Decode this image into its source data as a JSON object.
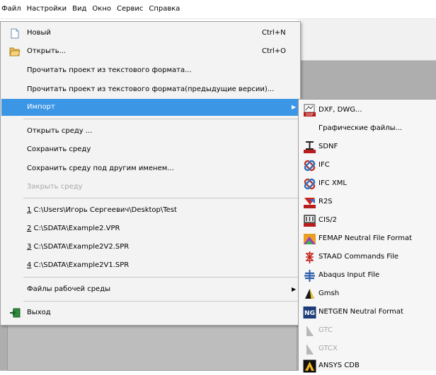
{
  "menubar": {
    "items": [
      "Файл",
      "Настройки",
      "Вид",
      "Окно",
      "Сервис",
      "Справка"
    ]
  },
  "file_menu": {
    "new": {
      "label": "Новый",
      "shortcut": "Ctrl+N",
      "icon": "new-file-icon"
    },
    "open": {
      "label": "Открыть...",
      "shortcut": "Ctrl+O",
      "icon": "open-folder-icon"
    },
    "read_text": {
      "label": "Прочитать проект из текстового формата..."
    },
    "read_text_old": {
      "label": "Прочитать проект из текстового формата(предыдущие версии)..."
    },
    "import": {
      "label": "Импорт"
    },
    "open_env": {
      "label": "Открыть среду ..."
    },
    "save_env": {
      "label": "Сохранить среду"
    },
    "save_env_as": {
      "label": "Сохранить среду под другим именем..."
    },
    "close_env": {
      "label": "Закрыть среду"
    },
    "recent": [
      {
        "num": "1",
        "path": " C:\\Users\\Игорь Сергеевич\\Desktop\\Test"
      },
      {
        "num": "2",
        "path": " C:\\SDATA\\Example2.VPR"
      },
      {
        "num": "3",
        "path": " C:\\SDATA\\Example2V2.SPR"
      },
      {
        "num": "4",
        "path": " C:\\SDATA\\Example2V1.SPR"
      }
    ],
    "workspace_files": {
      "label": "Файлы рабочей среды"
    },
    "exit": {
      "label": "Выход",
      "icon": "exit-icon"
    }
  },
  "import_submenu": [
    {
      "label": "DXF, DWG...",
      "icon": "dxf-icon",
      "enabled": true
    },
    {
      "label": "Графические файлы...",
      "icon": "",
      "enabled": true
    },
    {
      "label": "SDNF",
      "icon": "sdnf-icon",
      "enabled": true
    },
    {
      "label": "IFC",
      "icon": "ifc-icon",
      "enabled": true
    },
    {
      "label": "IFC XML",
      "icon": "ifc-xml-icon",
      "enabled": true
    },
    {
      "label": "R2S",
      "icon": "r2s-icon",
      "enabled": true
    },
    {
      "label": "CIS/2",
      "icon": "cis2-icon",
      "enabled": true
    },
    {
      "label": "FEMAP Neutral File Format",
      "icon": "femap-icon",
      "enabled": true
    },
    {
      "label": "STAAD Commands File",
      "icon": "staad-icon",
      "enabled": true
    },
    {
      "label": "Abaqus Input File",
      "icon": "abaqus-icon",
      "enabled": true
    },
    {
      "label": "Gmsh",
      "icon": "gmsh-icon",
      "enabled": true
    },
    {
      "label": "NETGEN Neutral Format",
      "icon": "netgen-icon",
      "enabled": true
    },
    {
      "label": "GTC",
      "icon": "gtc-icon",
      "enabled": false
    },
    {
      "label": "GTCX",
      "icon": "gtcx-icon",
      "enabled": false
    },
    {
      "label": "ANSYS CDB",
      "icon": "ansys-icon",
      "enabled": true
    }
  ],
  "colors": {
    "highlight": "#3c96e6",
    "menu_bg": "#f3f3f3",
    "app_bg": "#aeaeae",
    "disabled_text": "#a8a8a8"
  }
}
